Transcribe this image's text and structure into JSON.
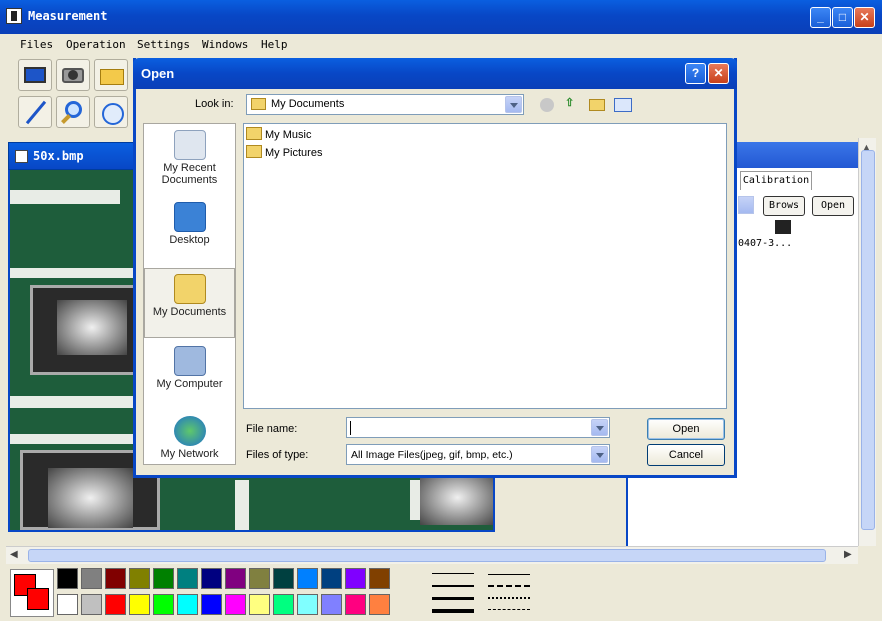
{
  "app": {
    "title": "Measurement",
    "image_window_title": "50x.bmp"
  },
  "menu": [
    "Files",
    "Operation",
    "Settings",
    "Windows",
    "Help"
  ],
  "right_panel": {
    "tab": "Calibration",
    "browse_label": "Brows",
    "open_label": "Open",
    "entry": "0407-3..."
  },
  "dialog": {
    "title": "Open",
    "look_in_label": "Look in:",
    "look_in_value": "My Documents",
    "places": [
      "My Recent Documents",
      "Desktop",
      "My Documents",
      "My Computer",
      "My Network"
    ],
    "files": [
      "My Music",
      "My Pictures"
    ],
    "file_name_label": "File name:",
    "file_name_value": "",
    "file_type_label": "Files of type:",
    "file_type_value": "All Image Files(jpeg, gif, bmp, etc.)",
    "open_label": "Open",
    "cancel_label": "Cancel"
  },
  "palette": {
    "foreground": "#ff0000",
    "row1": [
      "#000000",
      "#808080",
      "#800000",
      "#808000",
      "#008000",
      "#008080",
      "#000080",
      "#800080",
      "#808040",
      "#004040",
      "#0080ff",
      "#004080",
      "#8000ff",
      "#804000"
    ],
    "row2": [
      "#ffffff",
      "#c0c0c0",
      "#ff0000",
      "#ffff00",
      "#00ff00",
      "#00ffff",
      "#0000ff",
      "#ff00ff",
      "#ffff80",
      "#00ff80",
      "#80ffff",
      "#8080ff",
      "#ff0080",
      "#ff8040"
    ]
  }
}
